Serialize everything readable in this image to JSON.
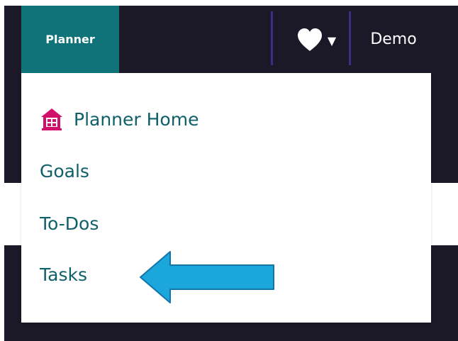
{
  "nav": {
    "planner_label": "Planner",
    "demo_label": "Demo",
    "heart_icon": "heart-icon",
    "caret_glyph": "▼"
  },
  "dropdown": {
    "items": [
      {
        "label": "Planner Home",
        "icon": "house-icon"
      },
      {
        "label": "Goals"
      },
      {
        "label": "To-Dos"
      },
      {
        "label": "Tasks"
      }
    ]
  },
  "annotation": {
    "icon": "arrow-left-icon",
    "color": "#1ca7dc"
  },
  "colors": {
    "dark_bg": "#1b1827",
    "planner_tab": "#10737a",
    "menu_text": "#10606a",
    "home_icon": "#d0106a",
    "divider": "#3a2f86"
  }
}
